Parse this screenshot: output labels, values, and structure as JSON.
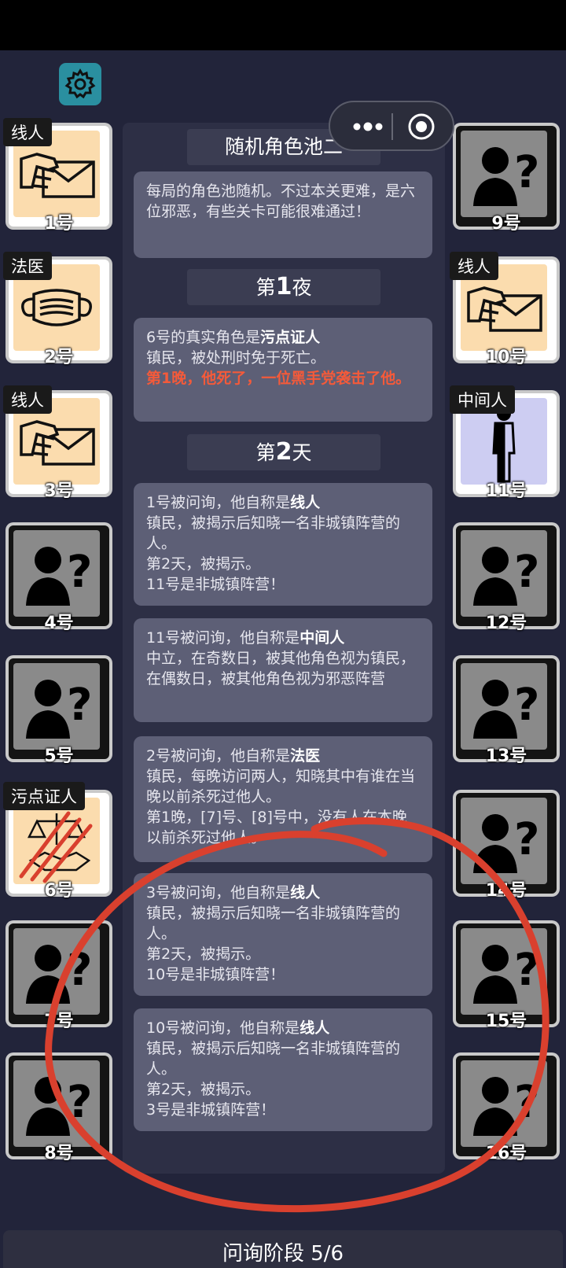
{
  "header": {
    "settings_icon": "gear-icon",
    "capsule": {
      "more_icon": "more-dots-icon",
      "close_icon": "target-circle-icon"
    }
  },
  "players": [
    {
      "num": "1号",
      "role": "线人",
      "icon": "envelope-hand-icon"
    },
    {
      "num": "2号",
      "role": "法医",
      "icon": "face-mask-icon"
    },
    {
      "num": "3号",
      "role": "线人",
      "icon": "envelope-hand-icon"
    },
    {
      "num": "4号",
      "role": "",
      "icon": "unknown-person-icon"
    },
    {
      "num": "5号",
      "role": "",
      "icon": "unknown-person-icon"
    },
    {
      "num": "6号",
      "role": "污点证人",
      "icon": "scales-handshake-icon"
    },
    {
      "num": "7号",
      "role": "",
      "icon": "unknown-person-icon"
    },
    {
      "num": "8号",
      "role": "",
      "icon": "unknown-person-icon"
    },
    {
      "num": "9号",
      "role": "",
      "icon": "unknown-person-icon"
    },
    {
      "num": "10号",
      "role": "线人",
      "icon": "envelope-hand-icon"
    },
    {
      "num": "11号",
      "role": "中间人",
      "icon": "half-person-icon"
    },
    {
      "num": "12号",
      "role": "",
      "icon": "unknown-person-icon"
    },
    {
      "num": "13号",
      "role": "",
      "icon": "unknown-person-icon"
    },
    {
      "num": "14号",
      "role": "",
      "icon": "unknown-person-icon"
    },
    {
      "num": "15号",
      "role": "",
      "icon": "unknown-person-icon"
    },
    {
      "num": "16号",
      "role": "",
      "icon": "unknown-person-icon"
    }
  ],
  "log": {
    "pool_title": "随机角色池二",
    "pool_desc": "每局的角色池随机。不过本关更难，是六位邪恶，有些关卡可能很难通过！",
    "night1": {
      "pre": "第",
      "n": "1",
      "post": "夜"
    },
    "night1_msg": {
      "l1_a": "6号的真实角色是",
      "l1_b": "污点证人",
      "l2": "镇民，被处刑时免于死亡。",
      "l3": "第1晚，他死了，一位黑手党袭击了他。"
    },
    "day2": {
      "pre": "第",
      "n": "2",
      "post": "天"
    },
    "entries": [
      {
        "head": "1号被问询，他自称是",
        "role": "线人",
        "body": "镇民，被揭示后知晓一名非城镇阵营的人。",
        "l3": "第2天，被揭示。",
        "l4": "11号是非城镇阵营！"
      },
      {
        "head": "11号被问询，他自称是",
        "role": "中间人",
        "body": "中立，在奇数日，被其他角色视为镇民，在偶数日，被其他角色视为邪恶阵营",
        "l3": "",
        "l4": ""
      },
      {
        "head": "2号被问询，他自称是",
        "role": "法医",
        "body": "镇民，每晚访问两人，知晓其中有谁在当晚以前杀死过他人。",
        "l3": "第1晚，[7]号、[8]号中，没有人在本晚以前杀死过他人。",
        "l4": ""
      },
      {
        "head": "3号被问询，他自称是",
        "role": "线人",
        "body": "镇民，被揭示后知晓一名非城镇阵营的人。",
        "l3": "第2天，被揭示。",
        "l4": "10号是非城镇阵营！"
      },
      {
        "head": "10号被问询，他自称是",
        "role": "线人",
        "body": "镇民，被揭示后知晓一名非城镇阵营的人。",
        "l3": "第2天，被揭示。",
        "l4": "3号是非城镇阵营！"
      }
    ]
  },
  "footer": {
    "phase": "问询阶段 5/6"
  },
  "colors": {
    "annotation": "#d9402e",
    "role_red": "#f45a3a",
    "card_cream": "#fbdcae"
  }
}
